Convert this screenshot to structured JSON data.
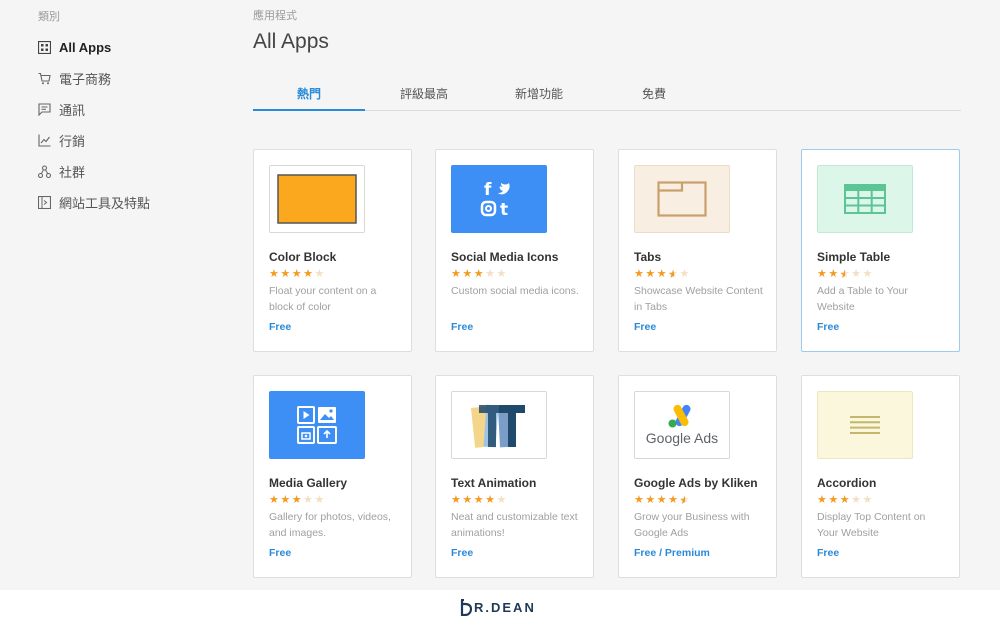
{
  "sidebar": {
    "heading": "類別",
    "items": [
      {
        "label": "All Apps",
        "icon": "grid-icon",
        "active": true
      },
      {
        "label": "電子商務",
        "icon": "cart-icon"
      },
      {
        "label": "通訊",
        "icon": "chat-icon"
      },
      {
        "label": "行銷",
        "icon": "chart-line-icon"
      },
      {
        "label": "社群",
        "icon": "network-icon"
      },
      {
        "label": "網站工具及特點",
        "icon": "tool-box-icon"
      }
    ]
  },
  "header": {
    "breadcrumb": "應用程式",
    "title": "All Apps"
  },
  "tabs": [
    {
      "label": "熱門",
      "active": true
    },
    {
      "label": "評級最高"
    },
    {
      "label": "新增功能"
    },
    {
      "label": "免費"
    }
  ],
  "apps": [
    {
      "title": "Color Block",
      "rating": 4,
      "desc": "Float your content on a block of color",
      "price": "Free",
      "thumb_bg": "#ffffff",
      "icon": "color-block-icon"
    },
    {
      "title": "Social Media Icons",
      "rating": 3,
      "desc": "Custom social media icons.",
      "price": "Free",
      "thumb_bg": "#3d8ef5",
      "icon": "social-media-icon"
    },
    {
      "title": "Tabs",
      "rating": 3.5,
      "desc": "Showcase Website Content in Tabs",
      "price": "Free",
      "thumb_bg": "#f8eee2",
      "icon": "tabs-icon"
    },
    {
      "title": "Simple Table",
      "rating": 2.5,
      "desc": "Add a Table to Your Website",
      "price": "Free",
      "thumb_bg": "#dcf6ea",
      "icon": "table-icon",
      "selected": true
    },
    {
      "title": "Media Gallery",
      "rating": 3,
      "desc": "Gallery for photos, videos, and images.",
      "price": "Free",
      "thumb_bg": "#3d8ef5",
      "icon": "media-gallery-icon"
    },
    {
      "title": "Text Animation",
      "rating": 4,
      "desc": "Neat and customizable text animations!",
      "price": "Free",
      "thumb_bg": "#ffffff",
      "icon": "text-animation-icon"
    },
    {
      "title": "Google Ads by Kliken",
      "rating": 4.5,
      "desc": "Grow your Business with Google Ads",
      "price": "Free / Premium",
      "thumb_bg": "#ffffff",
      "icon": "google-ads-logo",
      "logo_text": "Google Ads"
    },
    {
      "title": "Accordion",
      "rating": 3,
      "desc": "Display Top Content on Your Website",
      "price": "Free",
      "thumb_bg": "#faf7dc",
      "icon": "accordion-icon"
    }
  ],
  "footer": {
    "logo_text": "R.DEAN"
  },
  "colors": {
    "accent": "#2a8ad8",
    "star": "#f39a1f",
    "color_block_orange": "#fca81e",
    "social_blue": "#3d8ef5",
    "tabs_tan": "#c9a06c",
    "table_green": "#5cc596",
    "accordion_olive": "#c4b66c"
  }
}
